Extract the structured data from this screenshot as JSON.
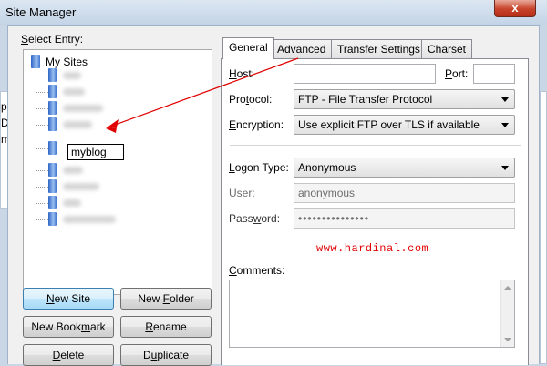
{
  "window": {
    "title": "Site Manager",
    "close_label": "x"
  },
  "left": {
    "select_entry": {
      "pre": "",
      "key": "S",
      "post": "elect Entry:"
    },
    "root_label": "My Sites",
    "rename_value": "myblog"
  },
  "buttons": {
    "new_site": {
      "pre": "",
      "key": "N",
      "post": "ew Site"
    },
    "new_folder": {
      "pre": "New ",
      "key": "F",
      "post": "older"
    },
    "new_bookmark": {
      "pre": "New Book",
      "key": "m",
      "post": "ark"
    },
    "rename": {
      "pre": "",
      "key": "R",
      "post": "ename"
    },
    "delete": {
      "pre": "",
      "key": "D",
      "post": "elete"
    },
    "duplicate": {
      "pre": "D",
      "key": "u",
      "post": "plicate"
    }
  },
  "tabs": [
    "General",
    "Advanced",
    "Transfer Settings",
    "Charset"
  ],
  "general": {
    "host": {
      "pre": "",
      "key": "H",
      "post": "ost:"
    },
    "host_value": "",
    "port": {
      "pre": "",
      "key": "P",
      "post": "ort:"
    },
    "port_value": "",
    "protocol": {
      "pre": "Pro",
      "key": "t",
      "post": "ocol:"
    },
    "protocol_value": "FTP - File Transfer Protocol",
    "encryption": {
      "pre": "",
      "key": "E",
      "post": "ncryption:"
    },
    "encryption_value": "Use explicit FTP over TLS if available",
    "logon_type": {
      "pre": "",
      "key": "L",
      "post": "ogon Type:"
    },
    "logon_type_value": "Anonymous",
    "user": {
      "pre": "",
      "key": "U",
      "post": "ser:"
    },
    "user_value": "anonymous",
    "password": {
      "pre": "Pass",
      "key": "w",
      "post": "ord:"
    },
    "password_value": "•••••••••••••••",
    "comments": {
      "pre": "",
      "key": "C",
      "post": "omments:"
    }
  },
  "watermark": "www.hardinal.com",
  "background_text": [
    "p",
    "D",
    "m"
  ],
  "colors": {
    "accent_red": "#e00000"
  }
}
